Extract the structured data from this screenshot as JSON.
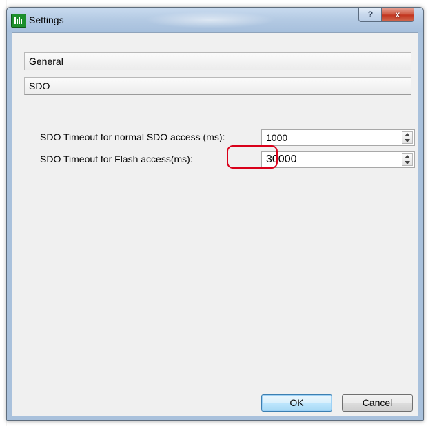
{
  "window": {
    "title": "Settings",
    "help_glyph": "?",
    "close_glyph": "x"
  },
  "sections": {
    "general_label": "General",
    "sdo_label": "SDO"
  },
  "sdo": {
    "normal_timeout_label": "SDO Timeout for normal SDO access (ms):",
    "normal_timeout_value": "1000",
    "flash_timeout_label": "SDO Timeout for Flash access(ms):",
    "flash_timeout_value": "30000"
  },
  "buttons": {
    "ok_label": "OK",
    "cancel_label": "Cancel"
  },
  "colors": {
    "highlight": "#d9001a",
    "close_button": "#c2351f",
    "titlebar": "#b5cbe4"
  },
  "icons": {
    "app": "app-icon",
    "help": "help-icon",
    "close": "close-icon",
    "spin_up": "arrow-up-icon",
    "spin_down": "arrow-down-icon"
  }
}
